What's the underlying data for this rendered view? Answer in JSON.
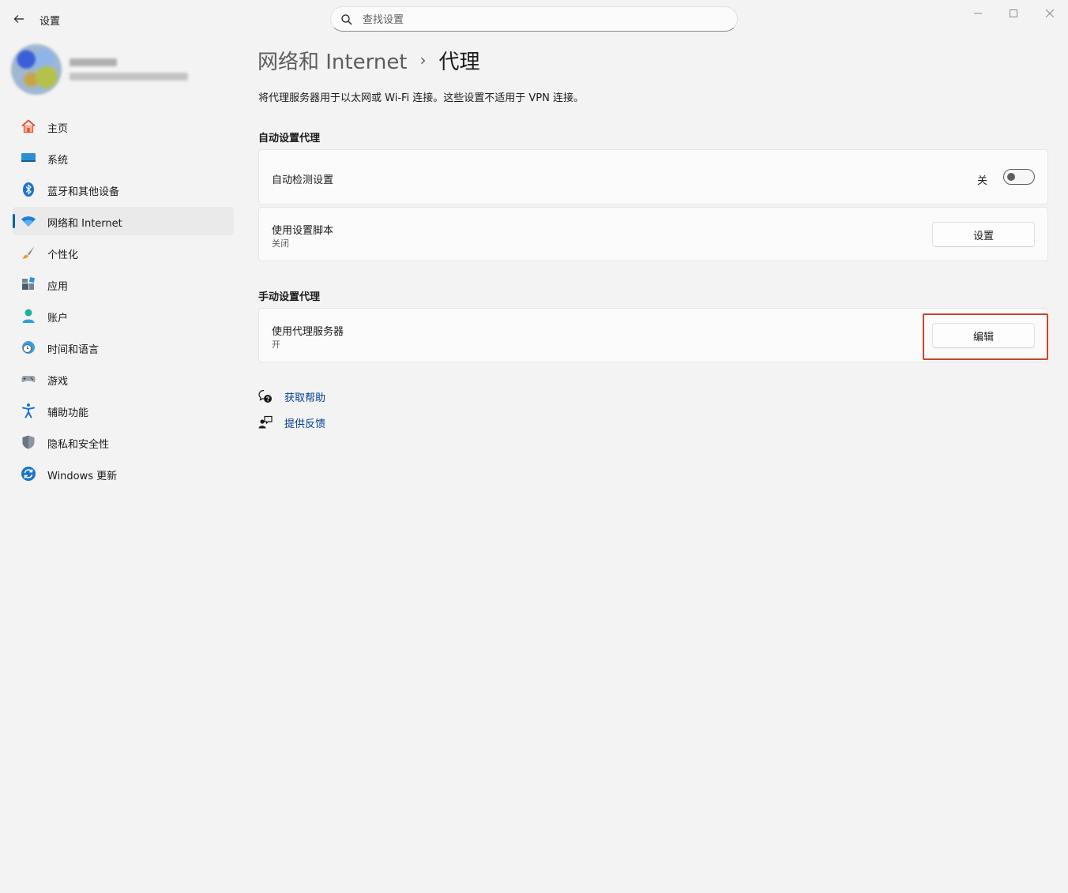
{
  "window": {
    "title": "设置",
    "controls": [
      "minimize-icon",
      "maximize-icon",
      "close-icon"
    ]
  },
  "search": {
    "placeholder": "查找设置",
    "value": ""
  },
  "sidebar": {
    "items": [
      {
        "label": "主页",
        "icon": "home-icon"
      },
      {
        "label": "系统",
        "icon": "system-icon"
      },
      {
        "label": "蓝牙和其他设备",
        "icon": "bluetooth-icon"
      },
      {
        "label": "网络和 Internet",
        "icon": "wifi-icon",
        "active": true
      },
      {
        "label": "个性化",
        "icon": "brush-icon"
      },
      {
        "label": "应用",
        "icon": "apps-icon"
      },
      {
        "label": "账户",
        "icon": "account-icon"
      },
      {
        "label": "时间和语言",
        "icon": "globe-clock-icon"
      },
      {
        "label": "游戏",
        "icon": "gamepad-icon"
      },
      {
        "label": "辅助功能",
        "icon": "accessibility-icon"
      },
      {
        "label": "隐私和安全性",
        "icon": "shield-icon"
      },
      {
        "label": "Windows 更新",
        "icon": "update-icon"
      }
    ]
  },
  "breadcrumb": {
    "parent": "网络和 Internet",
    "separator": "›",
    "current": "代理"
  },
  "description": "将代理服务器用于以太网或 Wi-Fi 连接。这些设置不适用于 VPN 连接。",
  "auto_section": {
    "title": "自动设置代理",
    "detect": {
      "title": "自动检测设置",
      "toggle_label": "关",
      "on": false
    },
    "script": {
      "title": "使用设置脚本",
      "subtitle": "关闭",
      "button": "设置"
    }
  },
  "manual_section": {
    "title": "手动设置代理",
    "proxy": {
      "title": "使用代理服务器",
      "subtitle": "开",
      "button": "编辑"
    }
  },
  "links": {
    "help": "获取帮助",
    "feedback": "提供反馈"
  },
  "colors": {
    "accent": "#005fb8",
    "link": "#003e92",
    "highlight_box": "#c8452b"
  }
}
